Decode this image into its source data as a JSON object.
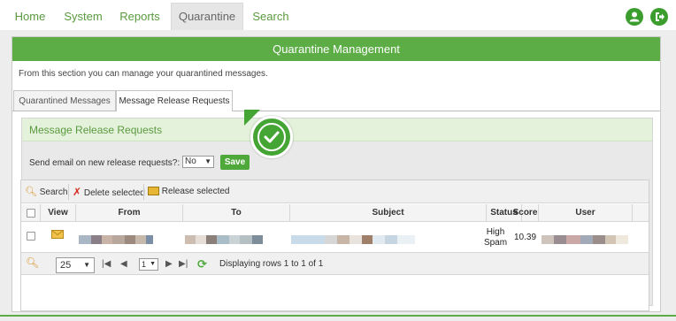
{
  "nav": {
    "tabs": [
      {
        "label": "Home"
      },
      {
        "label": "System"
      },
      {
        "label": "Reports"
      },
      {
        "label": "Quarantine",
        "active": true
      },
      {
        "label": "Search"
      }
    ],
    "icons": [
      "user-icon",
      "logout-icon"
    ]
  },
  "panel": {
    "title": "Quarantine Management",
    "intro": "From this section you can manage your quarantined messages.",
    "subtabs": [
      {
        "label": "Quarantined Messages"
      },
      {
        "label": "Message Release Requests",
        "active": true
      }
    ]
  },
  "section": {
    "title": "Message Release Requests",
    "email_label": "Send email on new release requests?:",
    "email_value": "No",
    "save_label": "Save"
  },
  "grid": {
    "toolbar": {
      "search": "Search",
      "delete": "Delete selected",
      "release": "Release selected"
    },
    "columns": [
      "View",
      "From",
      "To",
      "Subject",
      "Status",
      "Score",
      "User"
    ],
    "rows": [
      {
        "status_line1": "High",
        "status_line2": "Spam",
        "score": "10.39"
      }
    ],
    "pager": {
      "page_size": "25",
      "page": "1",
      "info": "Displaying rows 1 to 1 of 1"
    }
  },
  "colors": {
    "brand_green": "#5cad46",
    "nav_text": "#5a9a3e",
    "section_bg": "#e4f2dc"
  }
}
